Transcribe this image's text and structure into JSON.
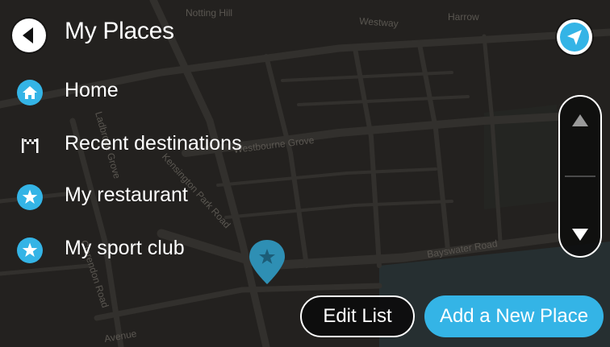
{
  "header": {
    "title": "My Places",
    "back_icon": "back-arrow-icon",
    "nav_icon": "navigation-arrow-icon"
  },
  "places": [
    {
      "label": "Home",
      "icon": "home-icon"
    },
    {
      "label": "Recent destinations",
      "icon": "checkered-flag-icon"
    },
    {
      "label": "My restaurant",
      "icon": "star-icon"
    },
    {
      "label": "My sport club",
      "icon": "star-icon"
    }
  ],
  "actions": {
    "edit_label": "Edit List",
    "add_label": "Add a New Place"
  },
  "map": {
    "labels": [
      "Notting Hill",
      "Westway",
      "Harrow",
      "Westbourne Grove",
      "Ladbroke Grove",
      "Kensington Park Road",
      "Clarendon Road",
      "Bayswater Road",
      "Avenue"
    ]
  },
  "colors": {
    "accent": "#34b4e6",
    "map_background": "#2b2926",
    "road": "#3e3b37",
    "water": "#2f3a3c"
  }
}
